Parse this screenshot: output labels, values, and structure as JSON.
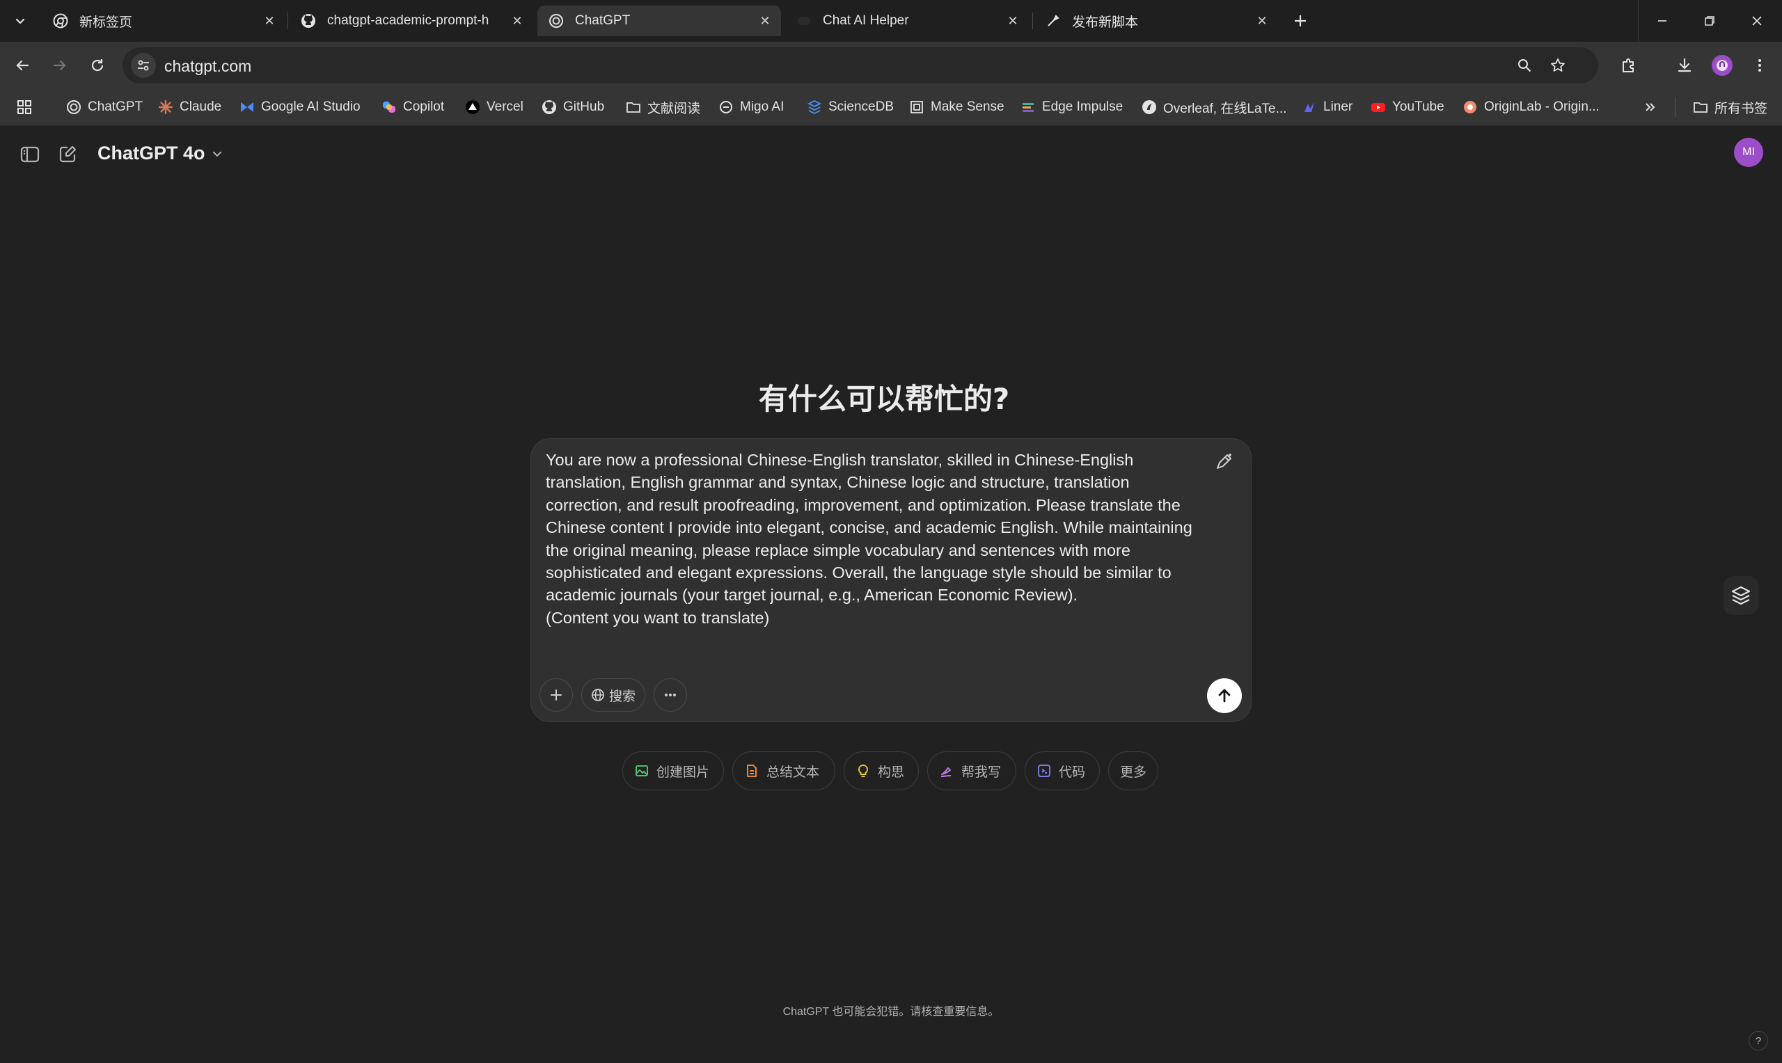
{
  "browser": {
    "tabs": [
      {
        "title": "新标签页",
        "favicon": "chrome-icon"
      },
      {
        "title": "chatgpt-academic-prompt-h",
        "favicon": "github-icon"
      },
      {
        "title": "ChatGPT",
        "favicon": "openai-icon",
        "active": true
      },
      {
        "title": "Chat AI Helper",
        "favicon": "chat-ai-helper-icon"
      },
      {
        "title": "发布新脚本",
        "favicon": "script-icon"
      }
    ],
    "url": "chatgpt.com",
    "bookmarks": [
      {
        "label": "ChatGPT",
        "icon": "openai-icon"
      },
      {
        "label": "Claude",
        "icon": "claude-icon"
      },
      {
        "label": "Google AI Studio",
        "icon": "ai-studio-icon"
      },
      {
        "label": "Copilot",
        "icon": "copilot-icon"
      },
      {
        "label": "Vercel",
        "icon": "vercel-icon"
      },
      {
        "label": "GitHub",
        "icon": "github-icon"
      },
      {
        "label": "文献阅读",
        "icon": "folder-icon"
      },
      {
        "label": "Migo AI",
        "icon": "migo-icon"
      },
      {
        "label": "ScienceDB",
        "icon": "sciencedb-icon"
      },
      {
        "label": "Make Sense",
        "icon": "make-sense-icon"
      },
      {
        "label": "Edge Impulse",
        "icon": "edge-impulse-icon"
      },
      {
        "label": "Overleaf, 在线LaTe...",
        "icon": "overleaf-icon"
      },
      {
        "label": "Liner",
        "icon": "liner-icon"
      },
      {
        "label": "YouTube",
        "icon": "youtube-icon"
      },
      {
        "label": "OriginLab - Origin...",
        "icon": "originlab-icon"
      }
    ],
    "all_bookmarks_label": "所有书签"
  },
  "chat": {
    "model_label": "ChatGPT 4o",
    "avatar_initials": "MI",
    "heading": "有什么可以帮忙的?",
    "input_text": "You are now a professional Chinese-English translator, skilled in Chinese-English translation, English grammar and syntax, Chinese logic and structure, translation correction, and result proofreading, improvement, and optimization. Please translate the Chinese content I provide into elegant, concise, and academic English. While maintaining the original meaning, please replace simple vocabulary and sentences with more sophisticated and elegant expressions. Overall, the language style should be similar to academic journals (your target journal, e.g., American Economic Review).\n(Content you want to translate)",
    "search_label": "搜索",
    "suggestions": [
      {
        "label": "创建图片",
        "icon": "image-icon",
        "color": "#4fbf6e"
      },
      {
        "label": "总结文本",
        "icon": "document-icon",
        "color": "#e8883a"
      },
      {
        "label": "构思",
        "icon": "lightbulb-icon",
        "color": "#e2c541"
      },
      {
        "label": "帮我写",
        "icon": "pen-icon",
        "color": "#c17be0"
      },
      {
        "label": "代码",
        "icon": "code-icon",
        "color": "#7b7be8"
      },
      {
        "label": "更多",
        "icon": "",
        "color": ""
      }
    ],
    "disclaimer": "ChatGPT 也可能会犯错。请核查重要信息。",
    "help_label": "?"
  },
  "colors": {
    "background": "#212121",
    "composer": "#303030",
    "avatar": "#9b4dca",
    "chrome_toolbar": "#353535"
  }
}
